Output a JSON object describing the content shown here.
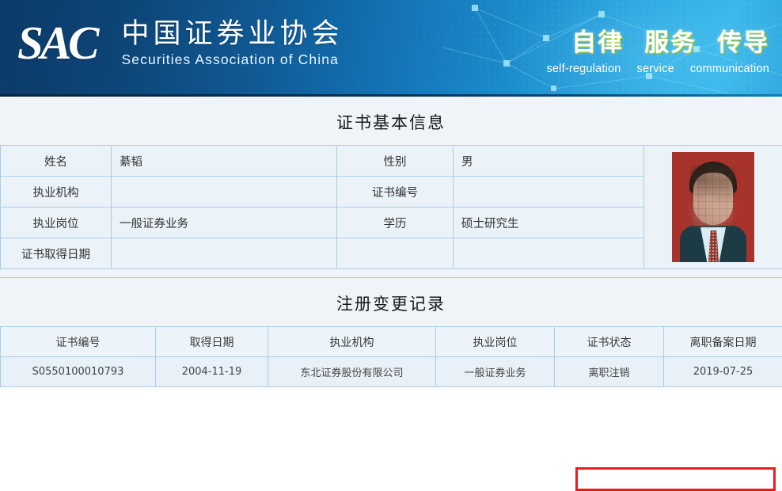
{
  "header": {
    "logo_text": "SAC",
    "org_name_cn": "中国证券业协会",
    "org_name_en": "Securities Association of China",
    "slogan_cn": [
      "自律",
      "服务",
      "传导"
    ],
    "slogan_en": [
      "self-regulation",
      "service",
      "communication"
    ],
    "banner_colors": {
      "dark_blue": "#0c3a68",
      "mid_blue": "#1476b8",
      "light_blue": "#35b4e8",
      "slogan_outline": "#a8d94a"
    }
  },
  "basic_info": {
    "title": "证书基本信息",
    "rows": [
      {
        "left_label": "姓名",
        "left_value": "綦韬",
        "right_label": "性别",
        "right_value": "男"
      },
      {
        "left_label": "执业机构",
        "left_value": "",
        "right_label": "证书编号",
        "right_value": ""
      },
      {
        "left_label": "执业岗位",
        "left_value": "一般证券业务",
        "right_label": "学历",
        "right_value": "硕士研究生"
      },
      {
        "left_label": "证书取得日期",
        "left_value": "",
        "right_label": "",
        "right_value": ""
      }
    ],
    "photo_alt": "id-photo"
  },
  "change_records": {
    "title": "注册变更记录",
    "columns": [
      "证书编号",
      "取得日期",
      "执业机构",
      "执业岗位",
      "证书状态",
      "离职备案日期"
    ],
    "rows": [
      {
        "certificate_no": "S0550100010793",
        "obtain_date": "2004-11-19",
        "institution": "东北证券股份有限公司",
        "position": "一般证券业务",
        "status": "离职注销",
        "departure_date": "2019-07-25"
      }
    ],
    "highlight_color": "#ee1c18"
  }
}
